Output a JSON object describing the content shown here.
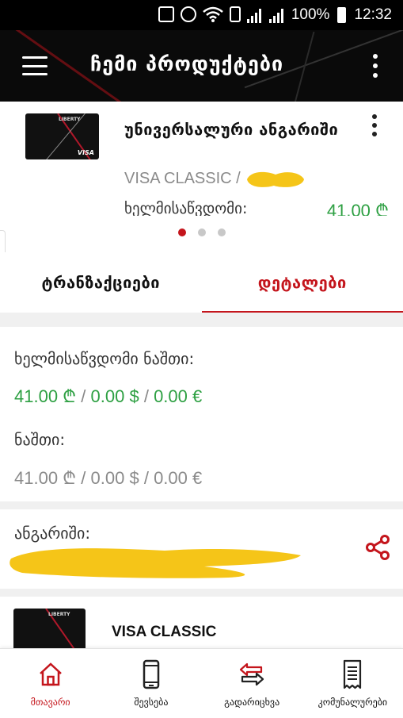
{
  "status_bar": {
    "battery": "100%",
    "time": "12:32",
    "icons": [
      "recycle-icon",
      "alarm-icon",
      "wifi-icon",
      "sim-icon",
      "signal-icon",
      "signal-icon",
      "battery-icon"
    ]
  },
  "app_bar": {
    "title": "ჩემი პროდუქტები",
    "menu_icon": "hamburger-icon",
    "overflow_icon": "more-vert-icon"
  },
  "product": {
    "name": "უნივერსალური ანგარიში",
    "card_type": "VISA CLASSIC /",
    "available_label": "ხელმისაწვდომი:",
    "available_value": "41.00 ₾",
    "card_brand": "LIBERTY",
    "card_network": "VISA",
    "carousel_pages": 3,
    "carousel_active": 1
  },
  "tabs": [
    {
      "label": "ტრანზაქციები",
      "active": false
    },
    {
      "label": "დეტალები",
      "active": true
    }
  ],
  "details": {
    "available_label": "ხელმისაწვდომი ნაშთი:",
    "available": {
      "gel": "41.00 ₾",
      "usd": "0.00 $",
      "eur": "0.00 €"
    },
    "balance_label": "ნაშთი:",
    "balance": {
      "gel": "41.00 ₾",
      "usd": "0.00 $",
      "eur": "0.00 €"
    },
    "separator": "/",
    "account_label": "ანგარიში:"
  },
  "next_product": {
    "name": "VISA CLASSIC",
    "card_brand": "LIBERTY"
  },
  "bottom_nav": [
    {
      "label": "მთავარი",
      "icon": "home-icon",
      "active": true
    },
    {
      "label": "შევსება",
      "icon": "phone-icon",
      "active": false
    },
    {
      "label": "გადარიცხვა",
      "icon": "transfer-icon",
      "active": false
    },
    {
      "label": "კომუნალურები",
      "icon": "receipt-icon",
      "active": false
    }
  ],
  "colors": {
    "accent": "#c4151c",
    "positive": "#2ea043",
    "muted": "#8a8a8a",
    "redaction": "#f5c518"
  }
}
